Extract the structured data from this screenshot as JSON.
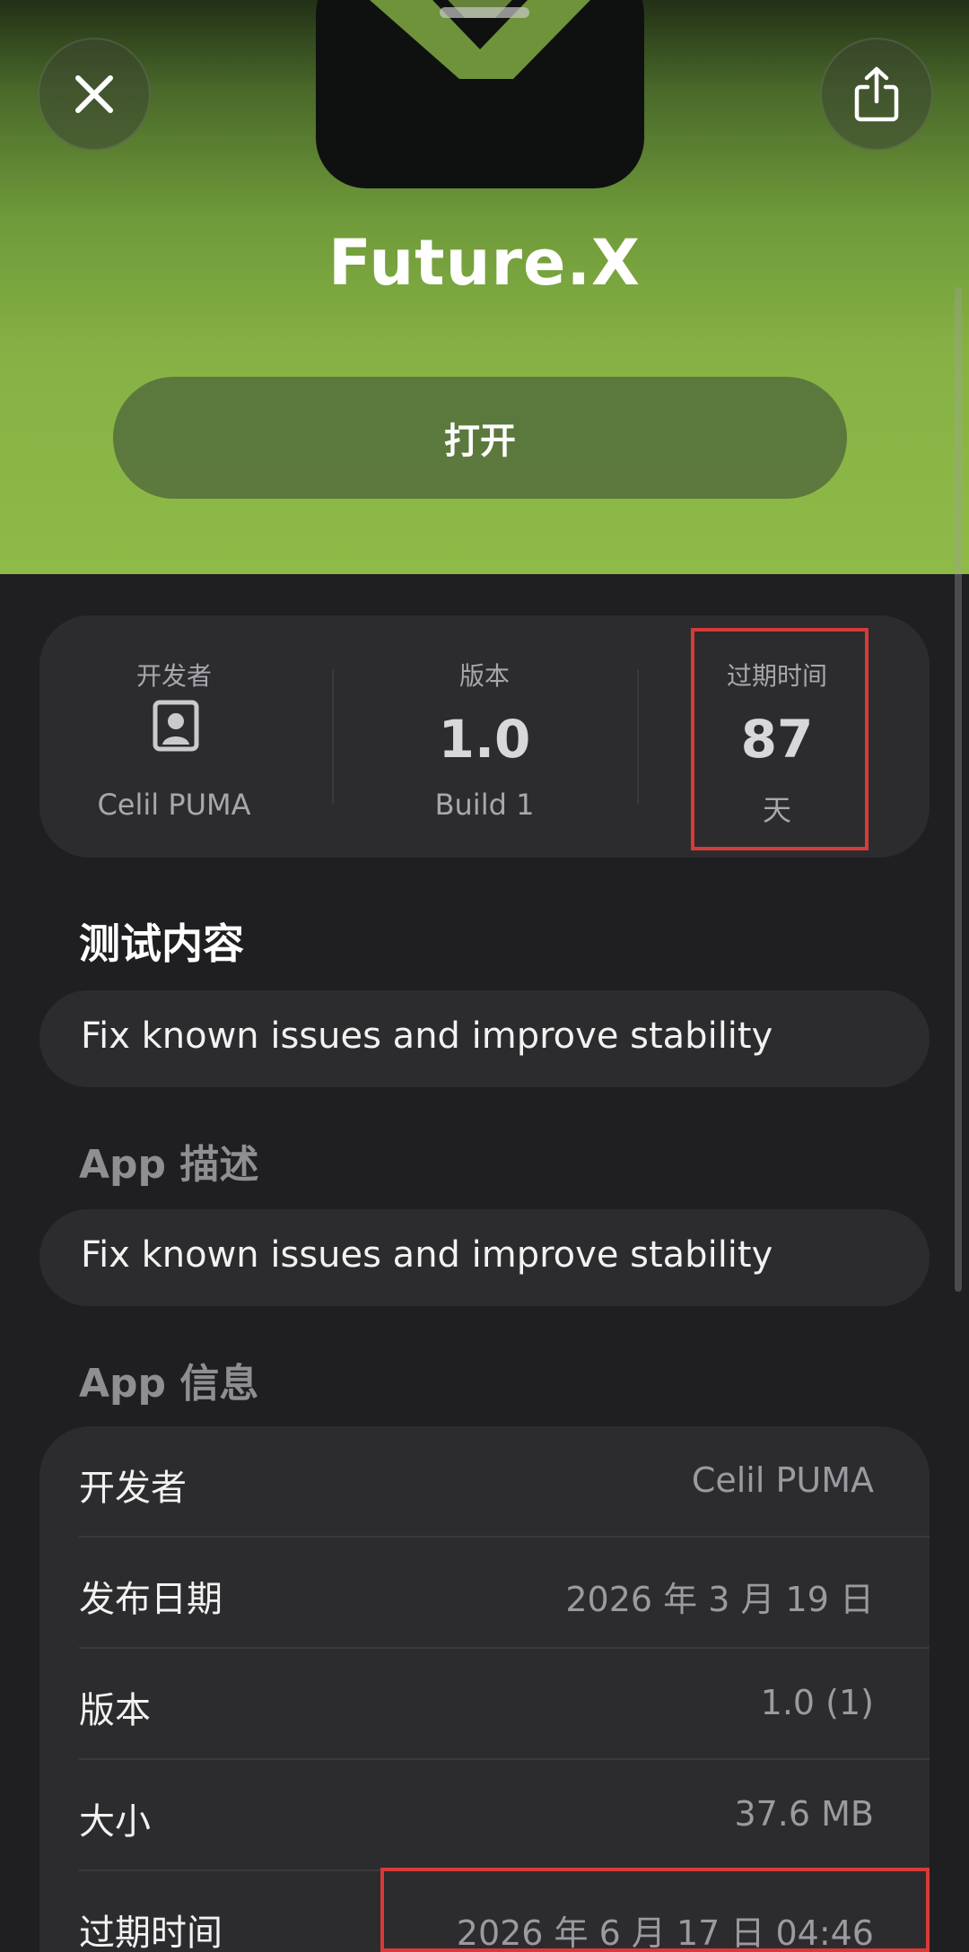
{
  "header": {
    "app_name": "Future.X",
    "open_label": "打开"
  },
  "stats": {
    "developer_label": "开发者",
    "developer_name": "Celil PUMA",
    "version_label": "版本",
    "version_value": "1.0",
    "build_label": "Build 1",
    "expiry_label": "过期时间",
    "expiry_value": "87",
    "expiry_unit": "天"
  },
  "test_content": {
    "title": "测试内容",
    "text": "Fix known issues and improve stability"
  },
  "description": {
    "title": "App 描述",
    "text": "Fix known issues and improve stability"
  },
  "app_info": {
    "title": "App 信息",
    "rows": [
      {
        "key": "开发者",
        "value": "Celil PUMA"
      },
      {
        "key": "发布日期",
        "value": "2026 年 3 月 19 日"
      },
      {
        "key": "版本",
        "value": "1.0 (1)"
      },
      {
        "key": "大小",
        "value": "37.6 MB"
      },
      {
        "key": "过期时间",
        "value": "2026 年 6 月 17 日 04:46"
      }
    ]
  },
  "icons": {
    "close": "close-icon",
    "share": "share-icon",
    "developer": "person-icon"
  },
  "colors": {
    "accent_green": "#86b245",
    "highlight_red": "#d73a3a",
    "card_bg": "#2c2c2e"
  }
}
